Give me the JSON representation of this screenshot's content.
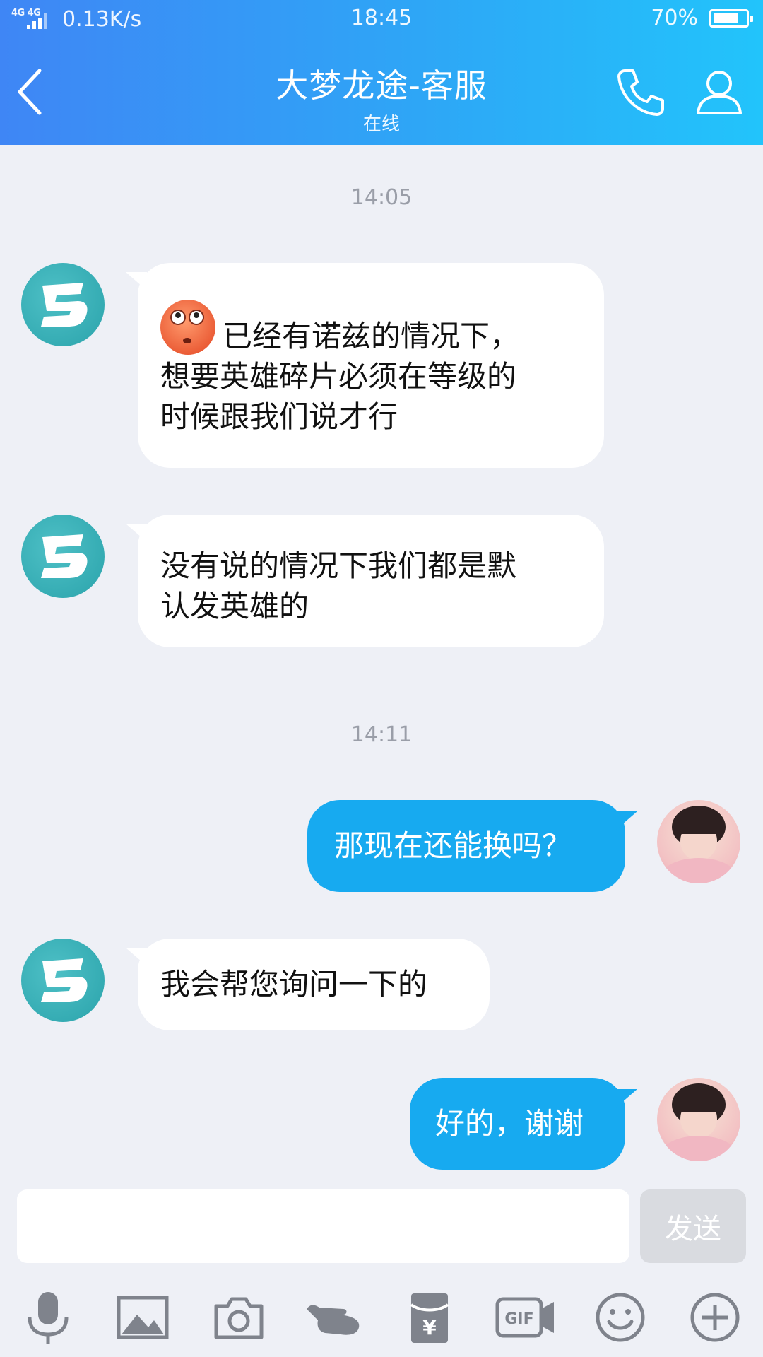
{
  "status_bar": {
    "network": "4G 4G",
    "speed": "0.13K/s",
    "time": "18:45",
    "battery": "70%",
    "battery_level": 0.7
  },
  "header": {
    "title": "大梦龙途-客服",
    "subtitle": "在线"
  },
  "messages": {
    "time1": "14:05",
    "m1_text": "已经有诺兹的情况下，想要英雄碎片必须在等级的时候跟我们说才行",
    "m1_line1": "已经有诺兹的情况下，",
    "m1_line2": "想要英雄碎片必须在等级的",
    "m1_line3": "时候跟我们说才行",
    "m2_line1": "没有说的情况下我们都是默",
    "m2_line2": "认发英雄的",
    "time2": "14:11",
    "m3": "那现在还能换吗？",
    "m4": "我会帮您询问一下的",
    "m5": "好的，谢谢"
  },
  "input": {
    "value": "",
    "placeholder": "",
    "send_label": "发送"
  },
  "toolbar": {
    "icons": [
      "microphone-icon",
      "image-icon",
      "camera-icon",
      "poke-hand-icon",
      "red-packet-icon",
      "gif-icon",
      "emoji-icon",
      "plus-icon"
    ],
    "gif_label": "GIF",
    "yen": "¥"
  },
  "colors": {
    "header_start": "#3f86f5",
    "header_end": "#22c4fb",
    "outgoing_bubble": "#17aaf0",
    "background": "#eef0f6"
  }
}
